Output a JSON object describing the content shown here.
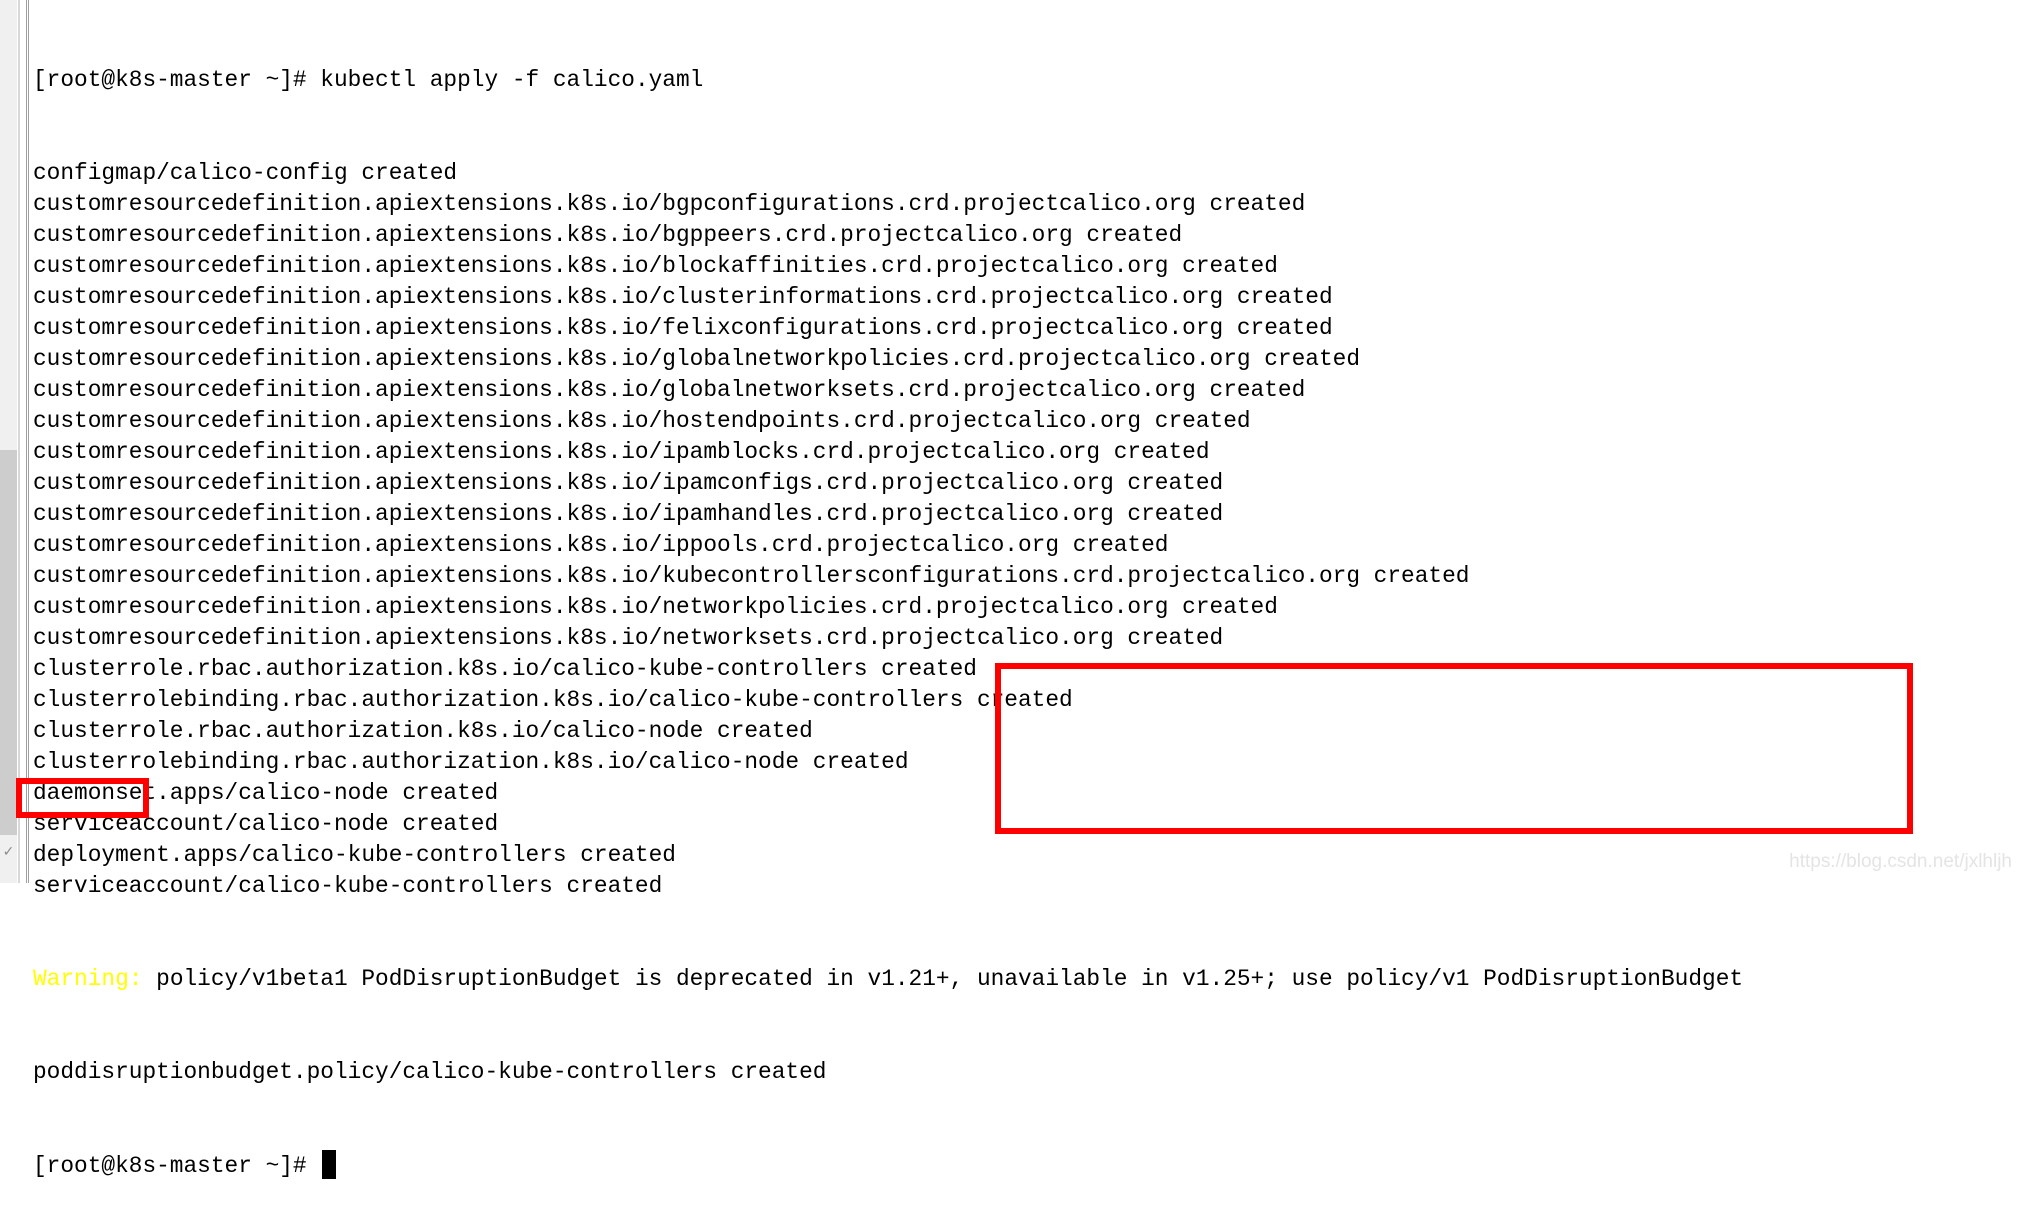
{
  "terminal": {
    "prompt": "[root@k8s-master ~]# ",
    "command": "kubectl apply -f calico.yaml",
    "output": [
      "configmap/calico-config created",
      "customresourcedefinition.apiextensions.k8s.io/bgpconfigurations.crd.projectcalico.org created",
      "customresourcedefinition.apiextensions.k8s.io/bgppeers.crd.projectcalico.org created",
      "customresourcedefinition.apiextensions.k8s.io/blockaffinities.crd.projectcalico.org created",
      "customresourcedefinition.apiextensions.k8s.io/clusterinformations.crd.projectcalico.org created",
      "customresourcedefinition.apiextensions.k8s.io/felixconfigurations.crd.projectcalico.org created",
      "customresourcedefinition.apiextensions.k8s.io/globalnetworkpolicies.crd.projectcalico.org created",
      "customresourcedefinition.apiextensions.k8s.io/globalnetworksets.crd.projectcalico.org created",
      "customresourcedefinition.apiextensions.k8s.io/hostendpoints.crd.projectcalico.org created",
      "customresourcedefinition.apiextensions.k8s.io/ipamblocks.crd.projectcalico.org created",
      "customresourcedefinition.apiextensions.k8s.io/ipamconfigs.crd.projectcalico.org created",
      "customresourcedefinition.apiextensions.k8s.io/ipamhandles.crd.projectcalico.org created",
      "customresourcedefinition.apiextensions.k8s.io/ippools.crd.projectcalico.org created",
      "customresourcedefinition.apiextensions.k8s.io/kubecontrollersconfigurations.crd.projectcalico.org created",
      "customresourcedefinition.apiextensions.k8s.io/networkpolicies.crd.projectcalico.org created",
      "customresourcedefinition.apiextensions.k8s.io/networksets.crd.projectcalico.org created",
      "clusterrole.rbac.authorization.k8s.io/calico-kube-controllers created",
      "clusterrolebinding.rbac.authorization.k8s.io/calico-kube-controllers created",
      "clusterrole.rbac.authorization.k8s.io/calico-node created",
      "clusterrolebinding.rbac.authorization.k8s.io/calico-node created",
      "daemonset.apps/calico-node created",
      "serviceaccount/calico-node created",
      "deployment.apps/calico-kube-controllers created",
      "serviceaccount/calico-kube-controllers created"
    ],
    "warning_label": "Warning:",
    "warning_text": " policy/v1beta1 PodDisruptionBudget is deprecated in v1.21+, unavailable in v1.25+; use policy/v1 PodDisruptionBudget",
    "after_warning": "poddisruptionbudget.policy/calico-kube-controllers created",
    "final_prompt": "[root@k8s-master ~]# "
  },
  "colors": {
    "warning": "#ffff00",
    "highlight_box": "#ff0000",
    "text": "#000000",
    "background": "#ffffff"
  },
  "watermark": "https://blog.csdn.net/jxlhljh"
}
